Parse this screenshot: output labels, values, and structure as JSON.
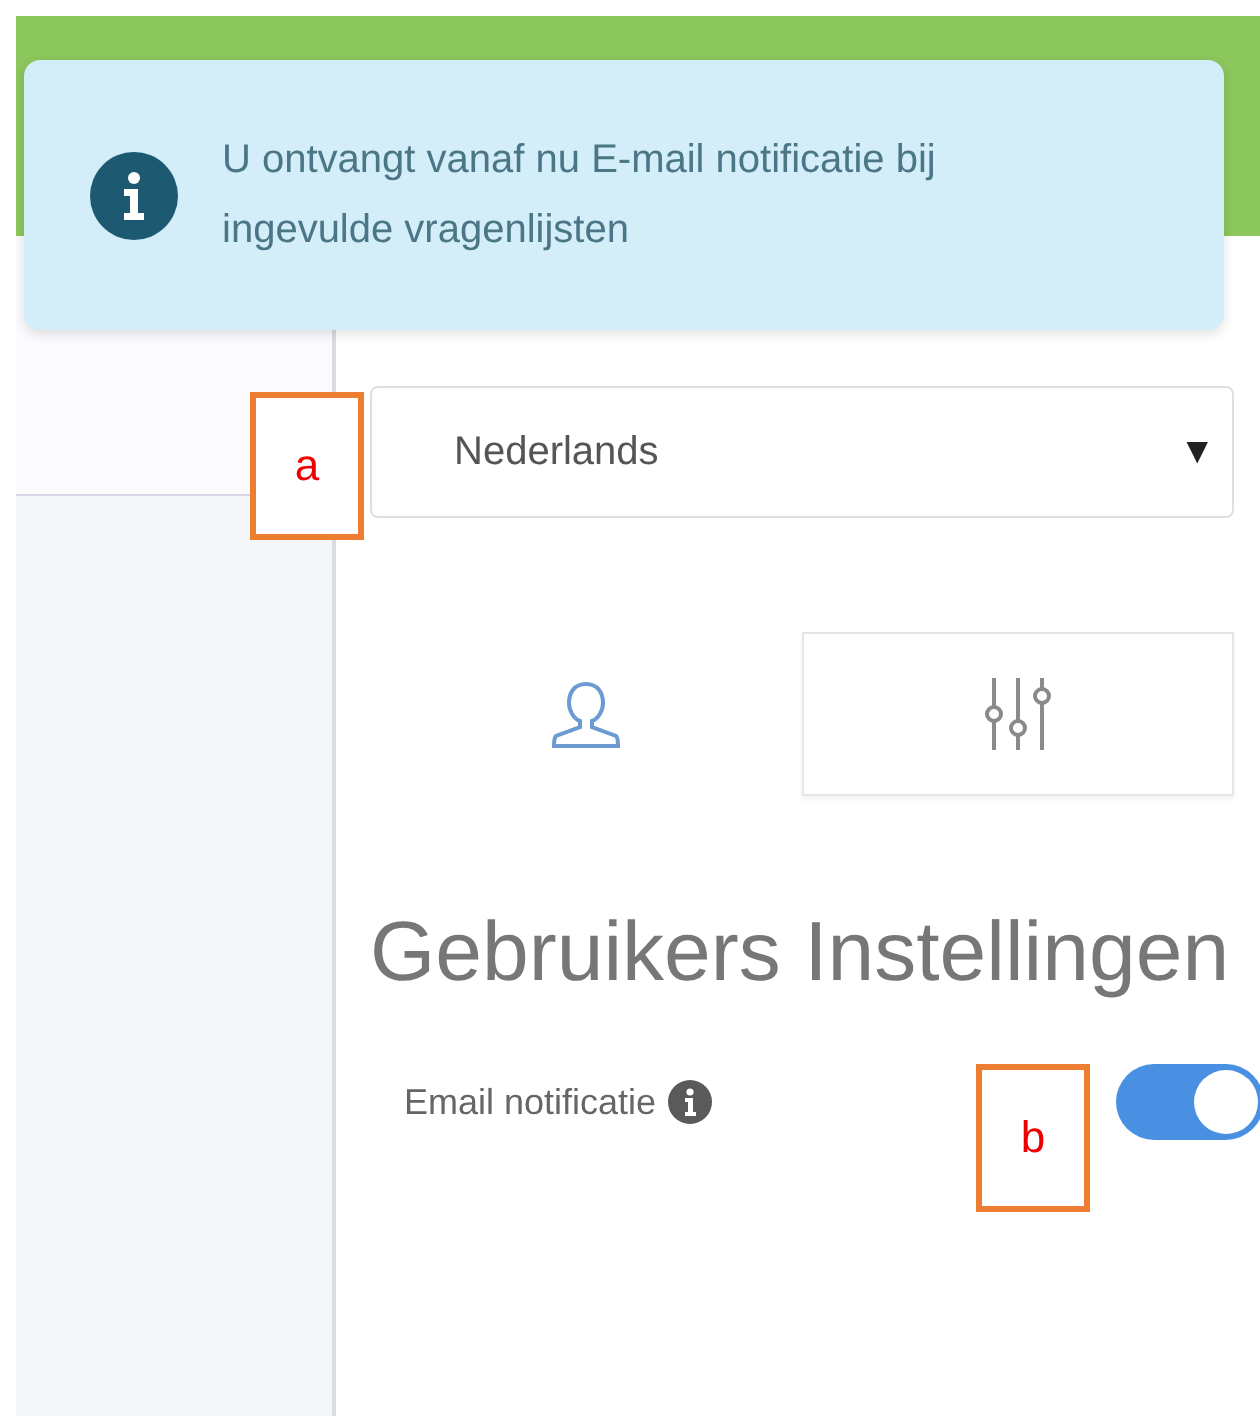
{
  "alert": {
    "text": "U ontvangt vanaf nu E-mail notificatie bij ingevulde vragenlijsten"
  },
  "language_select": {
    "value": "Nederlands",
    "caret": "▼"
  },
  "tabs": [
    {
      "kind": "user",
      "selected": true
    },
    {
      "kind": "sliders",
      "selected": false
    }
  ],
  "heading": "Gebruikers Instellingen",
  "settings": [
    {
      "label": "Email notificatie",
      "on": true
    }
  ],
  "callouts": [
    {
      "label": "a"
    },
    {
      "label": "b"
    }
  ]
}
